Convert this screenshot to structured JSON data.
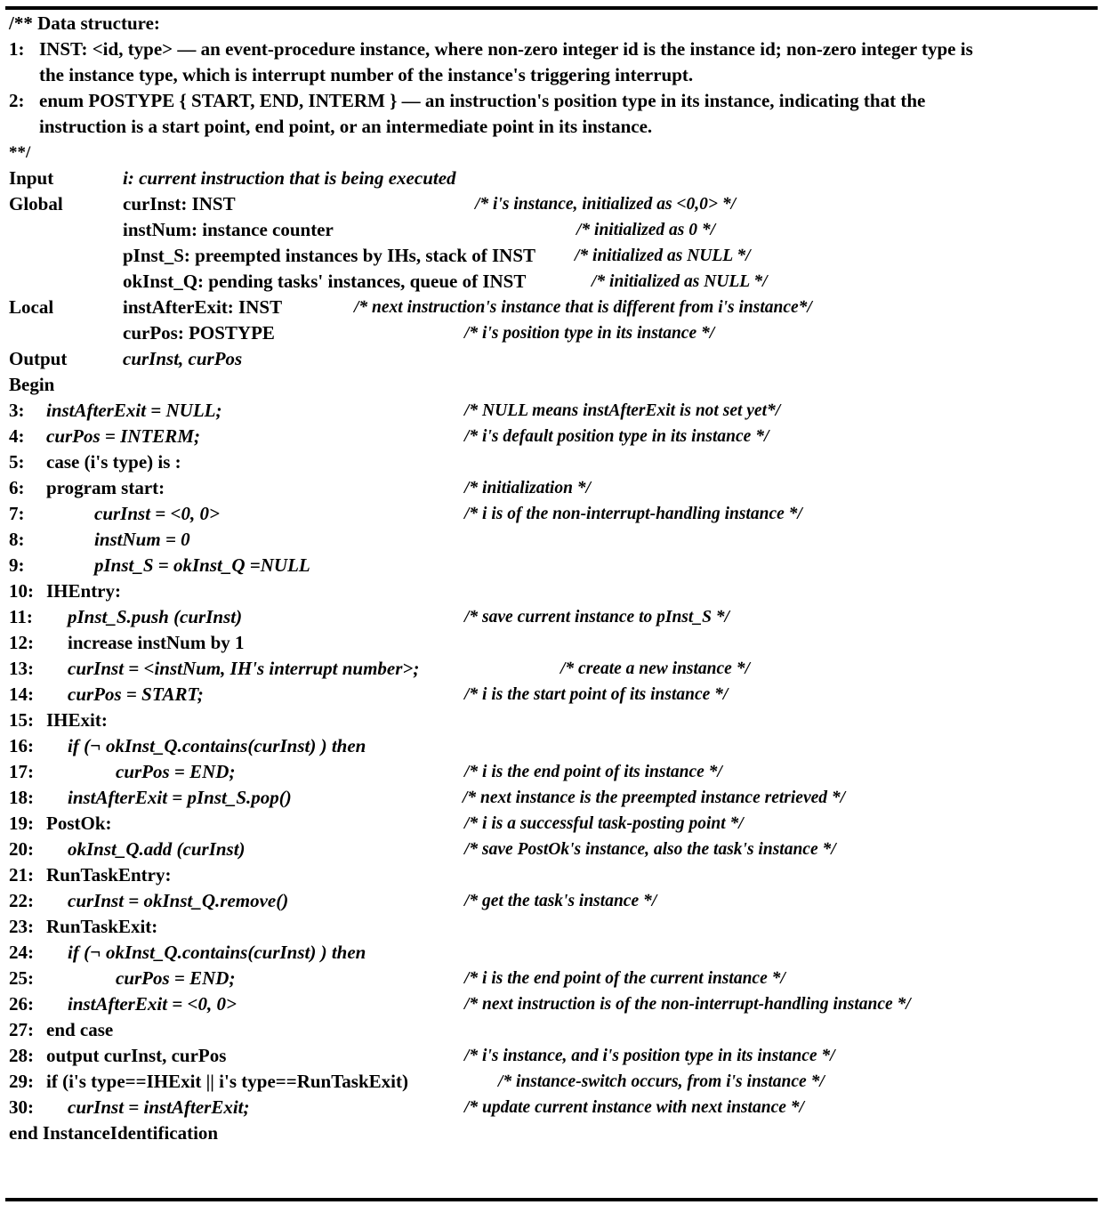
{
  "algorithm": {
    "doc_comment": {
      "open": "/** Data structure:",
      "close": "**/",
      "items": [
        {
          "num": "1:",
          "lines": [
            "INST: <id, type> — an event-procedure instance, where non-zero integer id is the instance id; non-zero integer type is",
            "the instance type, which is interrupt number of the instance's triggering interrupt."
          ]
        },
        {
          "num": "2:",
          "lines": [
            "enum POSTYPE { START, END, INTERM } — an instruction's position type in its instance, indicating that the",
            "instruction is a start point, end point, or an intermediate point in its instance."
          ]
        }
      ]
    },
    "sections": [
      {
        "label": "Input",
        "decl": "i:   current instruction that is being executed",
        "comment": ""
      },
      {
        "label": "Global",
        "decl": "curInst: INST",
        "comment": "/* i's instance, initialized as <0,0> */"
      },
      {
        "label": "",
        "decl": "instNum: instance counter",
        "comment": "/* initialized as 0 */"
      },
      {
        "label": "",
        "decl": "pInst_S: preempted instances by IHs, stack of INST",
        "comment": "/* initialized as NULL */"
      },
      {
        "label": "",
        "decl": "okInst_Q: pending tasks' instances, queue of INST",
        "comment": "/* initialized as NULL */"
      },
      {
        "label": "Local",
        "decl": "instAfterExit: INST",
        "comment": "/* next instruction's instance that is different from i's instance*/"
      },
      {
        "label": "",
        "decl": "curPos: POSTYPE",
        "comment": "/* i's position type in its instance */"
      },
      {
        "label": "Output",
        "decl": "curInst, curPos",
        "comment": ""
      }
    ],
    "begin_label": "Begin",
    "end_label": "end InstanceIdentification",
    "steps": [
      {
        "num": "3:",
        "code": "instAfterExit = NULL;",
        "comment": "/* NULL means instAfterExit is not set yet*/"
      },
      {
        "num": "4:",
        "code": "curPos = INTERM;",
        "comment": "/* i's default position type in its instance */"
      },
      {
        "num": "5:",
        "code": "case (i's type)  is :",
        "comment": ""
      },
      {
        "num": "6:",
        "code": "program start:",
        "comment": "/* initialization */"
      },
      {
        "num": "7:",
        "code": "curInst   = <0, 0>",
        "comment": "/* i is of the non-interrupt-handling instance */"
      },
      {
        "num": "8:",
        "code": "instNum = 0",
        "comment": ""
      },
      {
        "num": "9:",
        "code": "pInst_S = okInst_Q =NULL",
        "comment": ""
      },
      {
        "num": "10:",
        "code": "IHEntry:",
        "comment": ""
      },
      {
        "num": "11:",
        "code": "pInst_S.push (curInst)",
        "comment": "/* save current instance to pInst_S  */"
      },
      {
        "num": "12:",
        "code": "increase instNum by 1",
        "comment": ""
      },
      {
        "num": "13:",
        "code": "curInst = <instNum, IH's interrupt number>;",
        "comment": "/* create a new instance */"
      },
      {
        "num": "14:",
        "code": "curPos = START;",
        "comment": "/* i is the start point of its instance */"
      },
      {
        "num": "15:",
        "code": "IHExit:",
        "comment": ""
      },
      {
        "num": "16:",
        "code": "if  (¬ okInst_Q.contains(curInst) )   then",
        "comment": ""
      },
      {
        "num": "17:",
        "code": "curPos = END;",
        "comment": "/* i is the end point of its instance */"
      },
      {
        "num": "18:",
        "code": "instAfterExit = pInst_S.pop()",
        "comment": "/* next instance is the preempted instance retrieved */"
      },
      {
        "num": "19:",
        "code": "PostOk:",
        "comment": "/* i is a successful task-posting point */"
      },
      {
        "num": "20:",
        "code": "okInst_Q.add (curInst)",
        "comment": "/* save PostOk's instance, also the task's instance */"
      },
      {
        "num": "21:",
        "code": "RunTaskEntry:",
        "comment": ""
      },
      {
        "num": "22:",
        "code": "curInst =  okInst_Q.remove()",
        "comment": "/* get the task's instance */"
      },
      {
        "num": "23:",
        "code": "RunTaskExit:",
        "comment": ""
      },
      {
        "num": "24:",
        "code": "if  (¬ okInst_Q.contains(curInst) )   then",
        "comment": ""
      },
      {
        "num": "25:",
        "code": "curPos  = END;",
        "comment": "/* i is the end point of the current instance */"
      },
      {
        "num": "26:",
        "code": "instAfterExit = <0, 0>",
        "comment": "/* next instruction is of the non-interrupt-handling instance */"
      },
      {
        "num": "27:",
        "code": "end case",
        "comment": ""
      },
      {
        "num": "28:",
        "code": "output   curInst, curPos",
        "comment": "/* i's instance, and i's position type in its instance */"
      },
      {
        "num": "29:",
        "code": "if (i's type==IHExit || i's type==RunTaskExit)",
        "comment": "/* instance-switch occurs, from i's instance */"
      },
      {
        "num": "30:",
        "code": "curInst = instAfterExit;",
        "comment": "/* update current instance with next instance */"
      }
    ]
  }
}
